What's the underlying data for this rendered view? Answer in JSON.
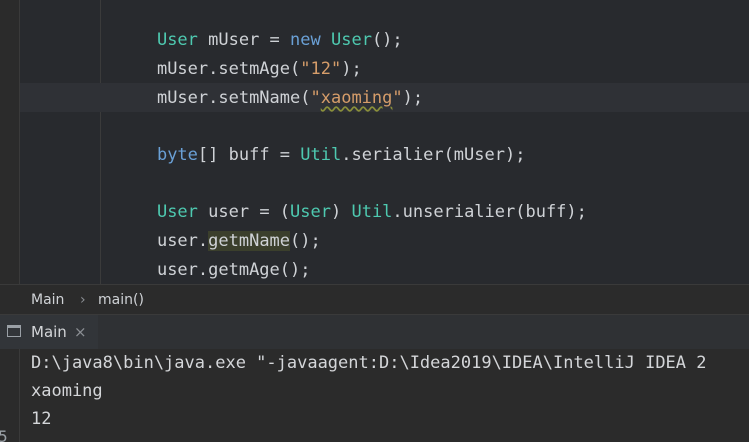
{
  "editor": {
    "line1": {
      "type": "User",
      "var": " mUser = ",
      "new": "new",
      "ctor": " User",
      "rest": "();"
    },
    "line2": {
      "obj": "mUser.setmAge(",
      "str": "\"12\"",
      "end": ");"
    },
    "line3": {
      "obj": "mUser.setmName(",
      "str_open": "\"",
      "str_text": "xaoming",
      "str_close": "\"",
      "end": ");"
    },
    "line5": {
      "type": "byte",
      "mid": "[] buff = ",
      "cls": "Util",
      "rest": ".serialier(mUser);"
    },
    "line7": {
      "type": "User",
      "mid1": " user = (",
      "cast": "User",
      "mid2": ") ",
      "cls": "Util",
      "rest": ".unserialier(buff);"
    },
    "line8": {
      "obj": "user.",
      "method": "getmName",
      "rest": "();"
    },
    "line9": {
      "text": "user.getmAge();"
    }
  },
  "breadcrumb": {
    "class": "Main",
    "separator": "›",
    "method": "main()"
  },
  "run_tab": {
    "label": "Main",
    "close": "×"
  },
  "console": {
    "line1": "D:\\java8\\bin\\java.exe \"-javaagent:D:\\Idea2019\\IDEA\\IntelliJ IDEA 2",
    "line2": "xaoming",
    "line3": "12",
    "side_digit": "5"
  }
}
